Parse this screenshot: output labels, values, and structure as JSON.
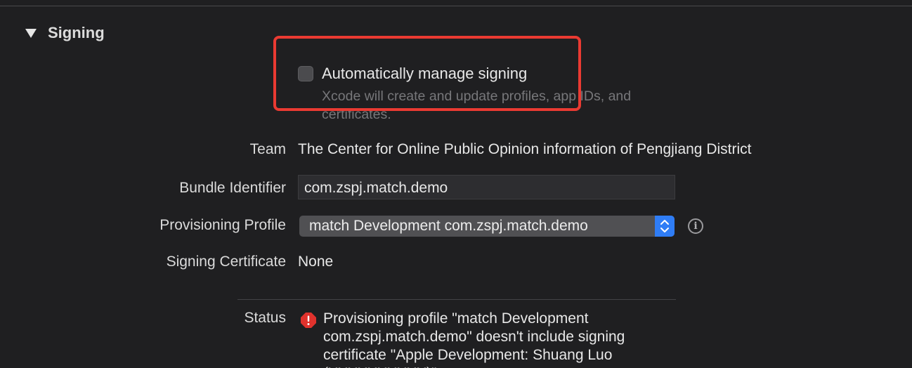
{
  "section": {
    "title": "Signing"
  },
  "auto_manage": {
    "label": "Automatically manage signing",
    "description": "Xcode will create and update profiles, app IDs, and certificates.",
    "checked": false
  },
  "fields": {
    "team": {
      "label": "Team",
      "value": "The Center for Online Public Opinion information of Pengjiang District"
    },
    "bundle_identifier": {
      "label": "Bundle Identifier",
      "value": "com.zspj.match.demo"
    },
    "provisioning_profile": {
      "label": "Provisioning Profile",
      "selected": "match Development com.zspj.match.demo"
    },
    "signing_certificate": {
      "label": "Signing Certificate",
      "value": "None"
    },
    "status": {
      "label": "Status",
      "message": "Provisioning profile \"match Development com.zspj.match.demo\" doesn't include signing certificate \"Apple Development: Shuang Luo (XXXXXXXXXX)\"."
    }
  },
  "icons": {
    "disclosure": "disclosure-triangle-icon",
    "info": "info-circle-icon",
    "error": "error-octagon-icon",
    "stepper": "up-down-chevron-icon"
  },
  "colors": {
    "background": "#1f1f21",
    "accent": "#2f7df6",
    "error": "#e0322d",
    "highlight": "#ea3a32"
  }
}
